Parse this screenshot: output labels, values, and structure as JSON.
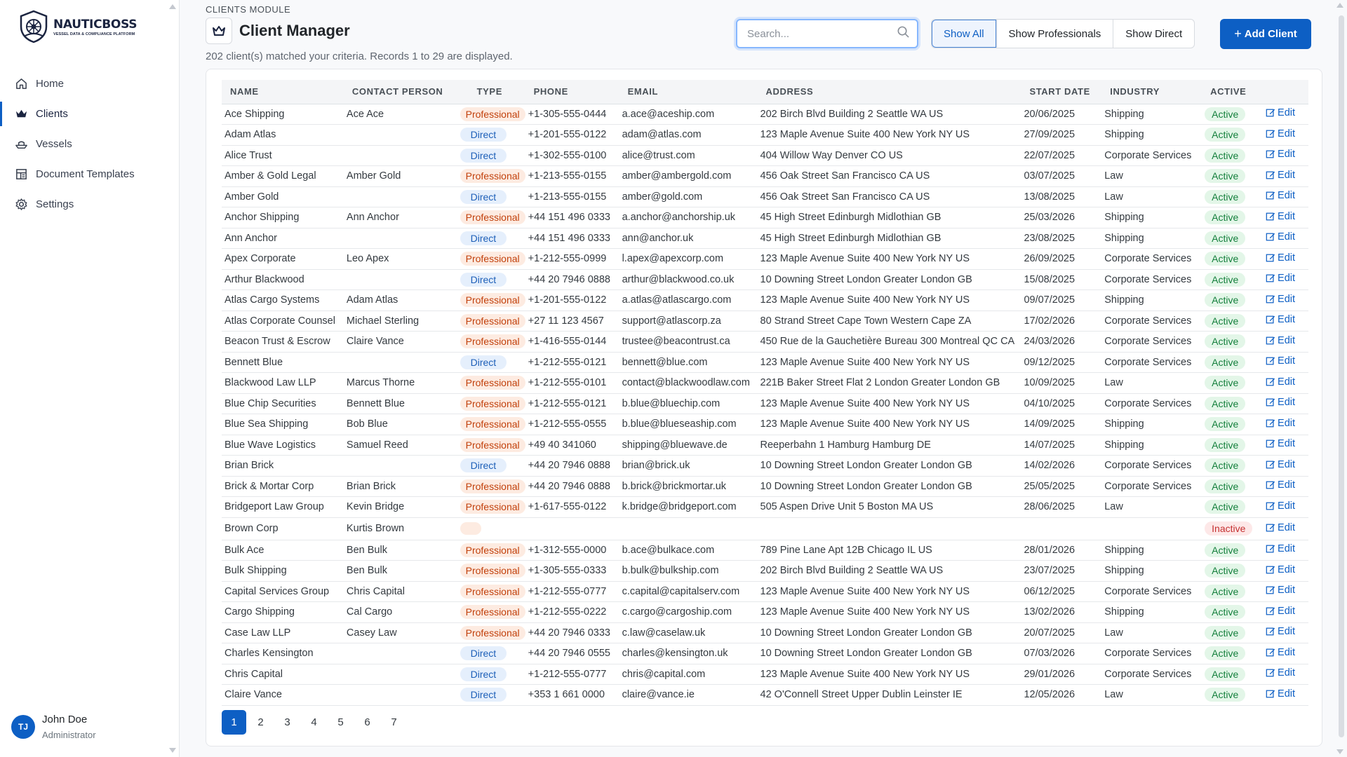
{
  "app": {
    "brand_name": "NAUTICBOSS",
    "brand_tagline": "VESSEL DATA & COMPLIANCE PLATFORM"
  },
  "sidebar": {
    "items": [
      {
        "label": "Home",
        "icon": "home-icon"
      },
      {
        "label": "Clients",
        "icon": "crown-icon",
        "active": true
      },
      {
        "label": "Vessels",
        "icon": "ship-icon"
      },
      {
        "label": "Document Templates",
        "icon": "template-icon"
      },
      {
        "label": "Settings",
        "icon": "gear-icon"
      }
    ],
    "user": {
      "initials": "TJ",
      "name": "John Doe",
      "role": "Administrator"
    }
  },
  "header": {
    "module_label": "CLIENTS MODULE",
    "title": "Client Manager",
    "summary": "202 client(s) matched your criteria. Records 1 to 29  are displayed."
  },
  "search": {
    "placeholder": "Search...",
    "value": ""
  },
  "filters": {
    "show_all": "Show All",
    "show_professionals": "Show Professionals",
    "show_direct": "Show Direct"
  },
  "add_button": {
    "label": "Add Client"
  },
  "table": {
    "columns": [
      "NAME",
      "CONTACT PERSON",
      "TYPE",
      "PHONE",
      "EMAIL",
      "ADDRESS",
      "START DATE",
      "INDUSTRY",
      "ACTIVE"
    ],
    "edit_label": "Edit",
    "rows": [
      {
        "name": "Ace Shipping",
        "contact": "Ace Ace",
        "type": "Professional",
        "phone": "+1-305-555-0444",
        "email": "a.ace@aceship.com",
        "address": "202 Birch Blvd Building 2 Seattle WA US",
        "start": "20/06/2025",
        "industry": "Shipping",
        "status": "Active"
      },
      {
        "name": "Adam Atlas",
        "contact": "",
        "type": "Direct",
        "phone": "+1-201-555-0122",
        "email": "adam@atlas.com",
        "address": "123 Maple Avenue Suite 400 New York NY US",
        "start": "27/09/2025",
        "industry": "Shipping",
        "status": "Active"
      },
      {
        "name": "Alice Trust",
        "contact": "",
        "type": "Direct",
        "phone": "+1-302-555-0100",
        "email": "alice@trust.com",
        "address": "404 Willow Way Denver CO US",
        "start": "22/07/2025",
        "industry": "Corporate Services",
        "status": "Active"
      },
      {
        "name": "Amber & Gold Legal",
        "contact": "Amber Gold",
        "type": "Professional",
        "phone": "+1-213-555-0155",
        "email": "amber@ambergold.com",
        "address": "456 Oak Street San Francisco CA US",
        "start": "03/07/2025",
        "industry": "Law",
        "status": "Active"
      },
      {
        "name": "Amber Gold",
        "contact": "",
        "type": "Direct",
        "phone": "+1-213-555-0155",
        "email": "amber@gold.com",
        "address": "456 Oak Street San Francisco CA US",
        "start": "13/08/2025",
        "industry": "Law",
        "status": "Active"
      },
      {
        "name": "Anchor Shipping",
        "contact": "Ann Anchor",
        "type": "Professional",
        "phone": "+44 151 496 0333",
        "email": "a.anchor@anchorship.uk",
        "address": "45 High Street Edinburgh Midlothian GB",
        "start": "25/03/2026",
        "industry": "Shipping",
        "status": "Active"
      },
      {
        "name": "Ann Anchor",
        "contact": "",
        "type": "Direct",
        "phone": "+44 151 496 0333",
        "email": "ann@anchor.uk",
        "address": "45 High Street Edinburgh Midlothian GB",
        "start": "23/08/2025",
        "industry": "Shipping",
        "status": "Active"
      },
      {
        "name": "Apex Corporate",
        "contact": "Leo Apex",
        "type": "Professional",
        "phone": "+1-212-555-0999",
        "email": "l.apex@apexcorp.com",
        "address": "123 Maple Avenue Suite 400 New York NY US",
        "start": "26/09/2025",
        "industry": "Corporate Services",
        "status": "Active"
      },
      {
        "name": "Arthur Blackwood",
        "contact": "",
        "type": "Direct",
        "phone": "+44 20 7946 0888",
        "email": "arthur@blackwood.co.uk",
        "address": "10 Downing Street London Greater London GB",
        "start": "15/08/2025",
        "industry": "Corporate Services",
        "status": "Active"
      },
      {
        "name": "Atlas Cargo Systems",
        "contact": "Adam Atlas",
        "type": "Professional",
        "phone": "+1-201-555-0122",
        "email": "a.atlas@atlascargo.com",
        "address": "123 Maple Avenue Suite 400 New York NY US",
        "start": "09/07/2025",
        "industry": "Shipping",
        "status": "Active"
      },
      {
        "name": "Atlas Corporate Counsel",
        "contact": "Michael Sterling",
        "type": "Professional",
        "phone": "+27 11 123 4567",
        "email": "support@atlascorp.za",
        "address": "80 Strand Street Cape Town Western Cape ZA",
        "start": "17/02/2026",
        "industry": "Corporate Services",
        "status": "Active"
      },
      {
        "name": "Beacon Trust & Escrow",
        "contact": "Claire Vance",
        "type": "Professional",
        "phone": "+1-416-555-0144",
        "email": "trustee@beacontrust.ca",
        "address": "450 Rue de la Gauchetière Bureau 300 Montreal QC CA",
        "start": "24/03/2026",
        "industry": "Corporate Services",
        "status": "Active"
      },
      {
        "name": "Bennett Blue",
        "contact": "",
        "type": "Direct",
        "phone": "+1-212-555-0121",
        "email": "bennett@blue.com",
        "address": "123 Maple Avenue Suite 400 New York NY US",
        "start": "09/12/2025",
        "industry": "Corporate Services",
        "status": "Active"
      },
      {
        "name": "Blackwood Law LLP",
        "contact": "Marcus Thorne",
        "type": "Professional",
        "phone": "+1-212-555-0101",
        "email": "contact@blackwoodlaw.com",
        "address": "221B Baker Street Flat 2 London Greater London GB",
        "start": "10/09/2025",
        "industry": "Law",
        "status": "Active"
      },
      {
        "name": "Blue Chip Securities",
        "contact": "Bennett Blue",
        "type": "Professional",
        "phone": "+1-212-555-0121",
        "email": "b.blue@bluechip.com",
        "address": "123 Maple Avenue Suite 400 New York NY US",
        "start": "04/10/2025",
        "industry": "Corporate Services",
        "status": "Active"
      },
      {
        "name": "Blue Sea Shipping",
        "contact": "Bob Blue",
        "type": "Professional",
        "phone": "+1-212-555-0555",
        "email": "b.blue@blueseaship.com",
        "address": "123 Maple Avenue Suite 400 New York NY US",
        "start": "14/09/2025",
        "industry": "Shipping",
        "status": "Active"
      },
      {
        "name": "Blue Wave Logistics",
        "contact": "Samuel Reed",
        "type": "Professional",
        "phone": "+49 40 341060",
        "email": "shipping@bluewave.de",
        "address": "Reeperbahn 1 Hamburg Hamburg DE",
        "start": "14/07/2025",
        "industry": "Shipping",
        "status": "Active"
      },
      {
        "name": "Brian Brick",
        "contact": "",
        "type": "Direct",
        "phone": "+44 20 7946 0888",
        "email": "brian@brick.uk",
        "address": "10 Downing Street London Greater London GB",
        "start": "14/02/2026",
        "industry": "Corporate Services",
        "status": "Active"
      },
      {
        "name": "Brick & Mortar Corp",
        "contact": "Brian Brick",
        "type": "Professional",
        "phone": "+44 20 7946 0888",
        "email": "b.brick@brickmortar.uk",
        "address": "10 Downing Street London Greater London GB",
        "start": "25/05/2025",
        "industry": "Corporate Services",
        "status": "Active"
      },
      {
        "name": "Bridgeport Law Group",
        "contact": "Kevin Bridge",
        "type": "Professional",
        "phone": "+1-617-555-0122",
        "email": "k.bridge@bridgeport.com",
        "address": "505 Aspen Drive Unit 5 Boston MA US",
        "start": "28/06/2025",
        "industry": "Law",
        "status": "Active"
      },
      {
        "name": "Brown Corp",
        "contact": "Kurtis Brown",
        "type": "",
        "phone": "",
        "email": "",
        "address": "",
        "start": "",
        "industry": "",
        "status": "Inactive"
      },
      {
        "name": "Bulk Ace",
        "contact": "Ben Bulk",
        "type": "Professional",
        "phone": "+1-312-555-0000",
        "email": "b.ace@bulkace.com",
        "address": "789 Pine Lane Apt 12B Chicago IL US",
        "start": "28/01/2026",
        "industry": "Shipping",
        "status": "Active"
      },
      {
        "name": "Bulk Shipping",
        "contact": "Ben Bulk",
        "type": "Professional",
        "phone": "+1-305-555-0333",
        "email": "b.bulk@bulkship.com",
        "address": "202 Birch Blvd Building 2 Seattle WA US",
        "start": "23/07/2025",
        "industry": "Shipping",
        "status": "Active"
      },
      {
        "name": "Capital Services Group",
        "contact": "Chris Capital",
        "type": "Professional",
        "phone": "+1-212-555-0777",
        "email": "c.capital@capitalserv.com",
        "address": "123 Maple Avenue Suite 400 New York NY US",
        "start": "06/12/2025",
        "industry": "Corporate Services",
        "status": "Active"
      },
      {
        "name": "Cargo Shipping",
        "contact": "Cal Cargo",
        "type": "Professional",
        "phone": "+1-212-555-0222",
        "email": "c.cargo@cargoship.com",
        "address": "123 Maple Avenue Suite 400 New York NY US",
        "start": "13/02/2026",
        "industry": "Shipping",
        "status": "Active"
      },
      {
        "name": "Case Law LLP",
        "contact": "Casey Law",
        "type": "Professional",
        "phone": "+44 20 7946 0333",
        "email": "c.law@caselaw.uk",
        "address": "10 Downing Street London Greater London GB",
        "start": "20/07/2025",
        "industry": "Law",
        "status": "Active"
      },
      {
        "name": "Charles Kensington",
        "contact": "",
        "type": "Direct",
        "phone": "+44 20 7946 0555",
        "email": "charles@kensington.uk",
        "address": "10 Downing Street London Greater London GB",
        "start": "07/03/2026",
        "industry": "Corporate Services",
        "status": "Active"
      },
      {
        "name": "Chris Capital",
        "contact": "",
        "type": "Direct",
        "phone": "+1-212-555-0777",
        "email": "chris@capital.com",
        "address": "123 Maple Avenue Suite 400 New York NY US",
        "start": "29/01/2026",
        "industry": "Corporate Services",
        "status": "Active"
      },
      {
        "name": "Claire Vance",
        "contact": "",
        "type": "Direct",
        "phone": "+353 1 661 0000",
        "email": "claire@vance.ie",
        "address": "42 O'Connell Street Upper Dublin Leinster IE",
        "start": "12/05/2026",
        "industry": "Law",
        "status": "Active"
      }
    ]
  },
  "pagination": {
    "pages": [
      "1",
      "2",
      "3",
      "4",
      "5",
      "6",
      "7"
    ],
    "current": "1"
  },
  "colors": {
    "primary": "#0d5fc4",
    "professional_bg": "#fdebe1",
    "professional_text": "#c2410c",
    "direct_bg": "#e5effc",
    "direct_text": "#1d5fb8",
    "active_bg": "#e3f6e8",
    "active_text": "#15803d",
    "inactive_bg": "#fde8e8",
    "inactive_text": "#c53030"
  }
}
